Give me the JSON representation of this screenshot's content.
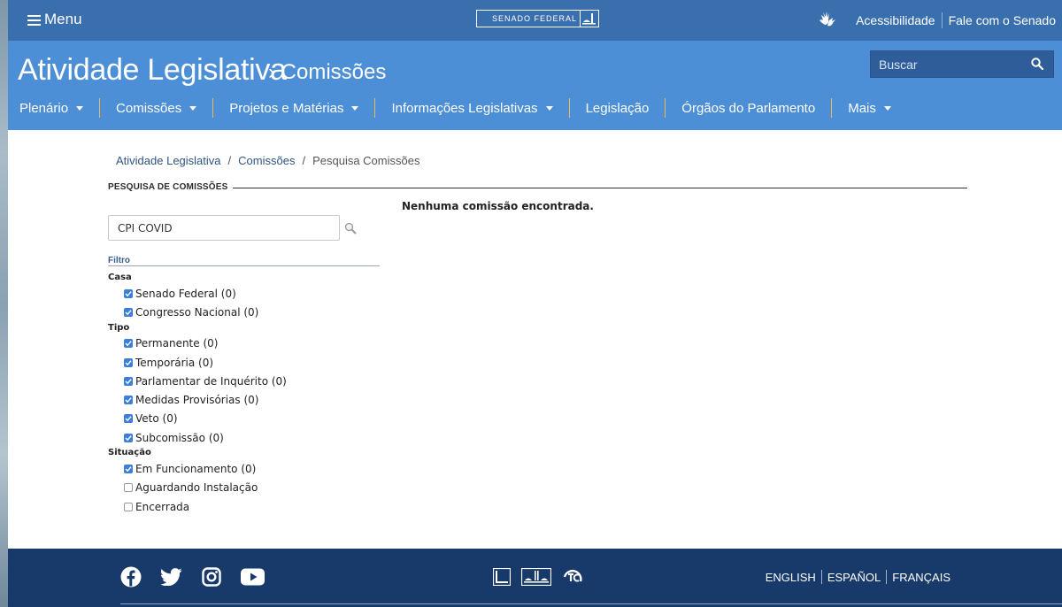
{
  "topbar": {
    "menu_label": "Menu",
    "logo_text": "SENADO FEDERAL",
    "accessibility_label": "Acessibilidade",
    "contact_label": "Fale com o Senado"
  },
  "header": {
    "title": "Atividade Legislativa",
    "subtitle": "› Comissões",
    "search_placeholder": "Buscar"
  },
  "nav": {
    "items": [
      {
        "label": "Plenário"
      },
      {
        "label": "Comissões"
      },
      {
        "label": "Projetos e Matérias"
      },
      {
        "label": "Informações Legislativas"
      },
      {
        "label": "Legislação"
      },
      {
        "label": "Órgãos do Parlamento"
      },
      {
        "label": "Mais"
      }
    ]
  },
  "breadcrumb": {
    "items": [
      "Atividade Legislativa",
      "Comissões",
      "Pesquisa Comissões"
    ],
    "separator": "/"
  },
  "section_title": "PESQUISA DE COMISSÕES",
  "result_message": "Nenhuma comissão encontrada.",
  "query_value": "CPI COVID",
  "filter_label": "Filtro",
  "filter_groups": [
    {
      "title": "Casa",
      "options": [
        {
          "label": "Senado Federal (0)",
          "checked": true
        },
        {
          "label": "Congresso Nacional (0)",
          "checked": true
        }
      ]
    },
    {
      "title": "Tipo",
      "options": [
        {
          "label": "Permanente (0)",
          "checked": true
        },
        {
          "label": "Temporária (0)",
          "checked": true
        },
        {
          "label": "Parlamentar de Inquérito (0)",
          "checked": true
        },
        {
          "label": "Medidas Provisórias (0)",
          "checked": true
        },
        {
          "label": "Veto (0)",
          "checked": true
        },
        {
          "label": "Subcomissão (0)",
          "checked": true
        }
      ]
    },
    {
      "title": "Situação",
      "options": [
        {
          "label": "Em Funcionamento (0)",
          "checked": true
        },
        {
          "label": "Aguardando Instalação",
          "checked": false
        },
        {
          "label": "Encerrada",
          "checked": false
        }
      ]
    }
  ],
  "footer": {
    "social_icons": [
      "facebook-icon",
      "twitter-icon",
      "instagram-icon",
      "youtube-icon"
    ],
    "languages": [
      "ENGLISH",
      "ESPAÑOL",
      "FRANÇAIS"
    ]
  },
  "colors": {
    "topbar": "#3a6fae",
    "header": "#4d8fd6",
    "nav_separator": "#f0b84c",
    "footer": "#183a6b",
    "checkbox": "#3b7fd9"
  }
}
